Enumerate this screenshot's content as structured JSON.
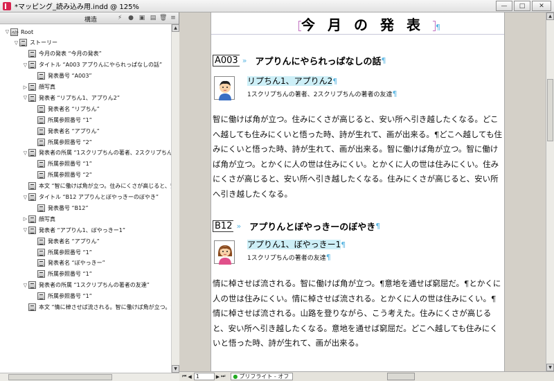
{
  "window": {
    "title": "*マッピング_読み込み用.indd @ 125%",
    "buttons": [
      "—",
      "□",
      "✕"
    ]
  },
  "structure_panel": {
    "title": "構造",
    "tools": [
      "⚡",
      "●",
      "▣",
      "▤",
      "🗑",
      "≡"
    ],
    "tree": [
      {
        "level": 0,
        "twisty": "▽",
        "icon": "root",
        "label": "Root"
      },
      {
        "level": 1,
        "twisty": "▽",
        "icon": "node",
        "label": "ストーリー"
      },
      {
        "level": 2,
        "twisty": "",
        "icon": "node",
        "label": "今月の発表 “今月の発表”"
      },
      {
        "level": 2,
        "twisty": "▽",
        "icon": "node",
        "label": "タイトル “A003 アプりんにやられっぱなしの話”"
      },
      {
        "level": 3,
        "twisty": "",
        "icon": "node",
        "label": "発表番号 “A003”"
      },
      {
        "level": 2,
        "twisty": "▷",
        "icon": "node",
        "label": "顔写真"
      },
      {
        "level": 2,
        "twisty": "▽",
        "icon": "node",
        "label": "発表者 “リプちん1、アプりん2”"
      },
      {
        "level": 3,
        "twisty": "",
        "icon": "node",
        "label": "発表者名 “リプちん”"
      },
      {
        "level": 3,
        "twisty": "",
        "icon": "node",
        "label": "所属参照番号 “1”"
      },
      {
        "level": 3,
        "twisty": "",
        "icon": "node",
        "label": "発表者名 “アプりん”"
      },
      {
        "level": 3,
        "twisty": "",
        "icon": "node",
        "label": "所属参照番号 “2”"
      },
      {
        "level": 2,
        "twisty": "▽",
        "icon": "node",
        "label": "発表者の所属 “1スクリプちんの著者、2スクリプちんの著者の友"
      },
      {
        "level": 3,
        "twisty": "",
        "icon": "node",
        "label": "所属参照番号 “1”"
      },
      {
        "level": 3,
        "twisty": "",
        "icon": "node",
        "label": "所属参照番号 “2”"
      },
      {
        "level": 2,
        "twisty": "",
        "icon": "node",
        "label": "本文 “智に働けば角が立つ。住みにくさが高じると、安い所へ引"
      },
      {
        "level": 2,
        "twisty": "▽",
        "icon": "node",
        "label": "タイトル “B12 アプりんとぼやっきーのぼやき”"
      },
      {
        "level": 3,
        "twisty": "",
        "icon": "node",
        "label": "発表番号 “B12”"
      },
      {
        "level": 2,
        "twisty": "▷",
        "icon": "node",
        "label": "顔写真"
      },
      {
        "level": 2,
        "twisty": "▽",
        "icon": "node",
        "label": "発表者 “アプりん1、ぼやっきー1”"
      },
      {
        "level": 3,
        "twisty": "",
        "icon": "node",
        "label": "発表者名 “アプりん”"
      },
      {
        "level": 3,
        "twisty": "",
        "icon": "node",
        "label": "所属参照番号 “1”"
      },
      {
        "level": 3,
        "twisty": "",
        "icon": "node",
        "label": "発表者名 “ぼやっきー”"
      },
      {
        "level": 3,
        "twisty": "",
        "icon": "node",
        "label": "所属参照番号 “1”"
      },
      {
        "level": 2,
        "twisty": "▽",
        "icon": "node",
        "label": "発表者の所属 “1スクリプちんの著者の友達”"
      },
      {
        "level": 3,
        "twisty": "",
        "icon": "node",
        "label": "所属参照番号 “1”"
      },
      {
        "level": 2,
        "twisty": "",
        "icon": "node",
        "label": "本文 “情に棹させば流される。智に働けば角が立つ。意地を通"
      }
    ]
  },
  "document": {
    "page_title": "今月の発表",
    "articles": [
      {
        "code": "A003",
        "title": "アプりんにやられっぱなしの話",
        "presenters_line": "リプちん1、アプりん2",
        "affiliation_line": "1スクリプちんの著者、2スクリプちんの著者の友達",
        "avatar": "boy-avatar",
        "body": "智に働けば角が立つ。住みにくさが高じると、安い所へ引き越したくなる。どこへ越しても住みにくいと悟った時、詩が生れて、画が出来る。¶どこへ越しても住みにくいと悟った時、詩が生れて、画が出来る。智に働けば角が立つ。智に働けば角が立つ。とかくに人の世は住みにくい。とかくに人の世は住みにくい。住みにくさが高じると、安い所へ引き越したくなる。住みにくさが高じると、安い所へ引き越したくなる。"
      },
      {
        "code": "B12",
        "title": "アプりんとぼやっきーのぼやき",
        "presenters_line": "アプりん1、ぼやっきー1",
        "affiliation_line": "1スクリプちんの著者の友達",
        "avatar": "girl-avatar",
        "body": "情に棹させば流される。智に働けば角が立つ。¶意地を通せば窮屈だ。¶とかくに人の世は住みにくい。情に棹させば流される。とかくに人の世は住みにくい。¶情に棹させば流される。山路を登りながら、こう考えた。住みにくさが高じると、安い所へ引き越したくなる。意地を通せば窮屈だ。どこへ越しても住みにくいと悟った時、詩が生れて、画が出来る。"
      }
    ]
  },
  "statusbar": {
    "page_number": "1",
    "preflight": "プリフライト - オフ"
  },
  "colors": {
    "tag_bracket": "#c070c0",
    "pilcrow": "#5bb6e2",
    "highlight": "#cdeff7"
  }
}
